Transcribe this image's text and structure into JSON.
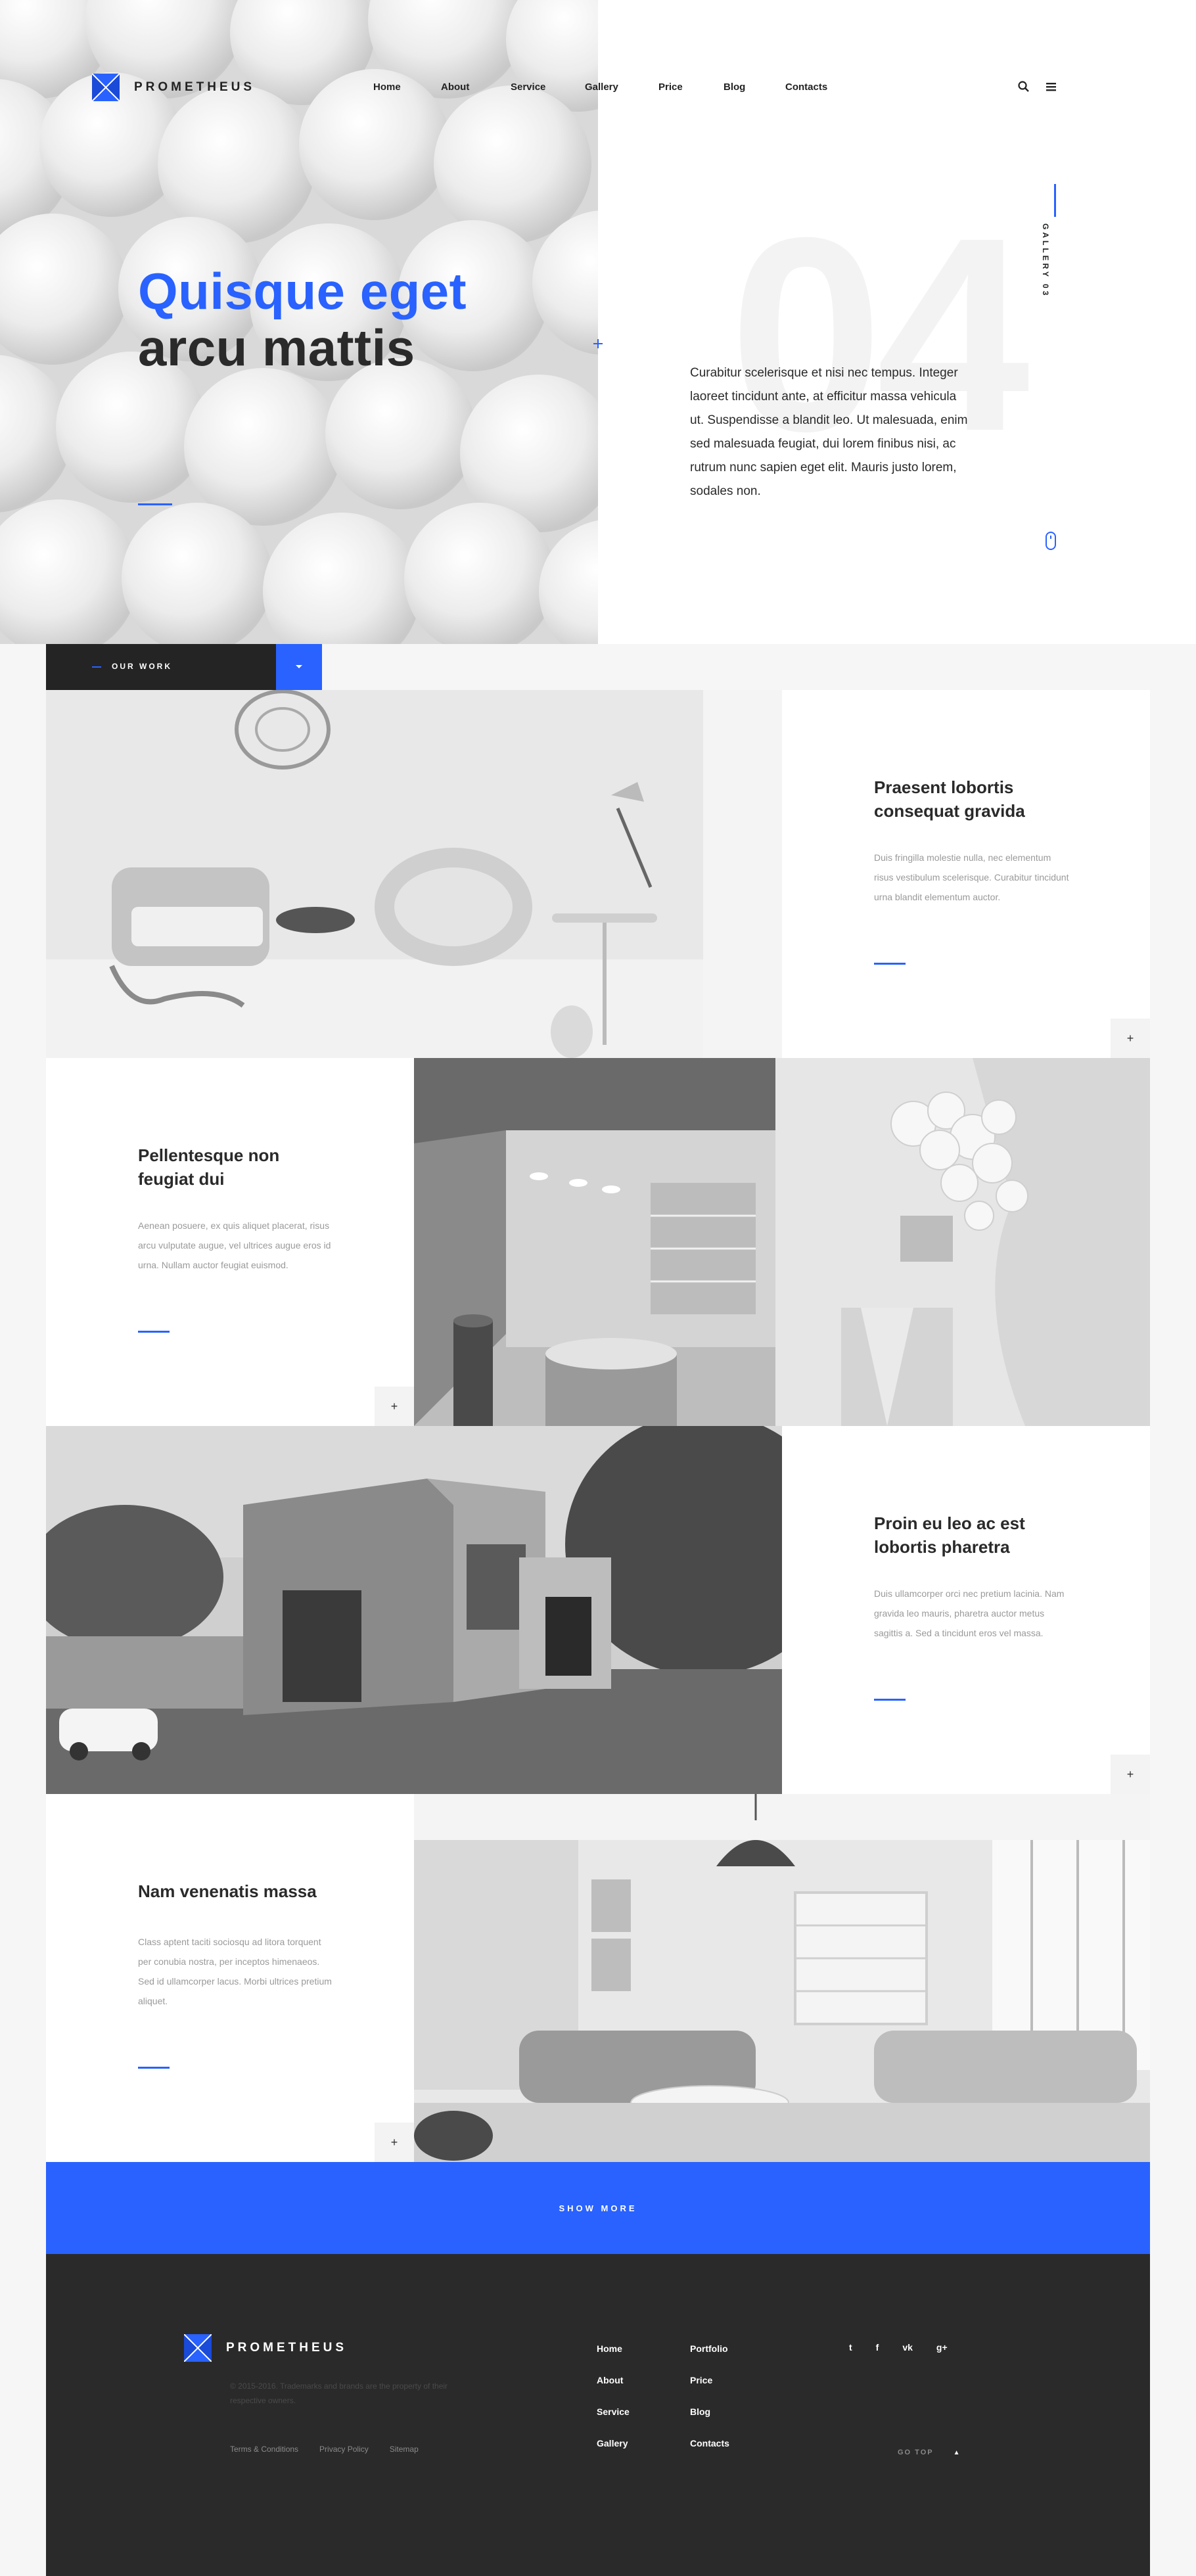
{
  "brand": {
    "name": "PROMETHEUS",
    "accent": "#2962ff",
    "dark": "#2a2a2a"
  },
  "nav": [
    {
      "label": "Home"
    },
    {
      "label": "About"
    },
    {
      "label": "Service"
    },
    {
      "label": "Gallery"
    },
    {
      "label": "Price"
    },
    {
      "label": "Blog"
    },
    {
      "label": "Contacts"
    }
  ],
  "header_icons": [
    "search-icon",
    "menu-icon"
  ],
  "hero": {
    "title_line1": "Quisque eget",
    "title_line2": "arcu mattis",
    "big_number": "04",
    "text": "Curabitur scelerisque et nisi nec tempus. Integer laoreet tincidunt ante, at efficitur massa vehicula ut. Suspendisse a blandit leo. Ut malesuada, enim sed malesuada feugiat, dui lorem finibus nisi, ac rutrum nunc sapien eget elit. Mauris justo lorem, sodales non.",
    "side_label": "GALLERY 03"
  },
  "work": {
    "label": "OUR WORK"
  },
  "cards": [
    {
      "title": "Praesent lobortis consequat gravida",
      "text": "Duis fringilla molestie nulla, nec elementum risus vestibulum scelerisque. Curabitur tincidunt urna blandit elementum auctor.",
      "plus": "+"
    },
    {
      "title": "Pellentesque non feugiat dui",
      "text": "Aenean posuere, ex quis aliquet placerat, risus arcu vulputate augue, vel ultrices augue eros id urna. Nullam auctor feugiat euismod.",
      "plus": "+"
    },
    {
      "title": "Proin eu leo ac est lobortis pharetra",
      "text": "Duis ullamcorper orci nec pretium lacinia. Nam gravida leo mauris, pharetra auctor metus sagittis a. Sed a tincidunt eros vel massa.",
      "plus": "+"
    },
    {
      "title": "Nam venenatis massa",
      "text": "Class aptent taciti sociosqu ad litora torquent per conubia nostra, per inceptos himenaeos. Sed id ullamcorper lacus. Morbi ultrices pretium aliquet.",
      "plus": "+"
    }
  ],
  "show_more": {
    "label": "SHOW MORE"
  },
  "footer": {
    "brand": "PROMETHEUS",
    "copyright": "© 2015-2016. Trademarks and brands are the property of their respective owners.",
    "links": [
      "Terms & Conditions",
      "Privacy Policy",
      "Sitemap"
    ],
    "col1": [
      "Home",
      "About",
      "Service",
      "Gallery"
    ],
    "col2": [
      "Portfolio",
      "Price",
      "Blog",
      "Contacts"
    ],
    "socials": [
      "twitter-icon",
      "facebook-icon",
      "vk-icon",
      "google-plus-icon"
    ],
    "social_glyphs": [
      "t",
      "f",
      "vk",
      "g+"
    ],
    "gotop": "GO TOP"
  }
}
